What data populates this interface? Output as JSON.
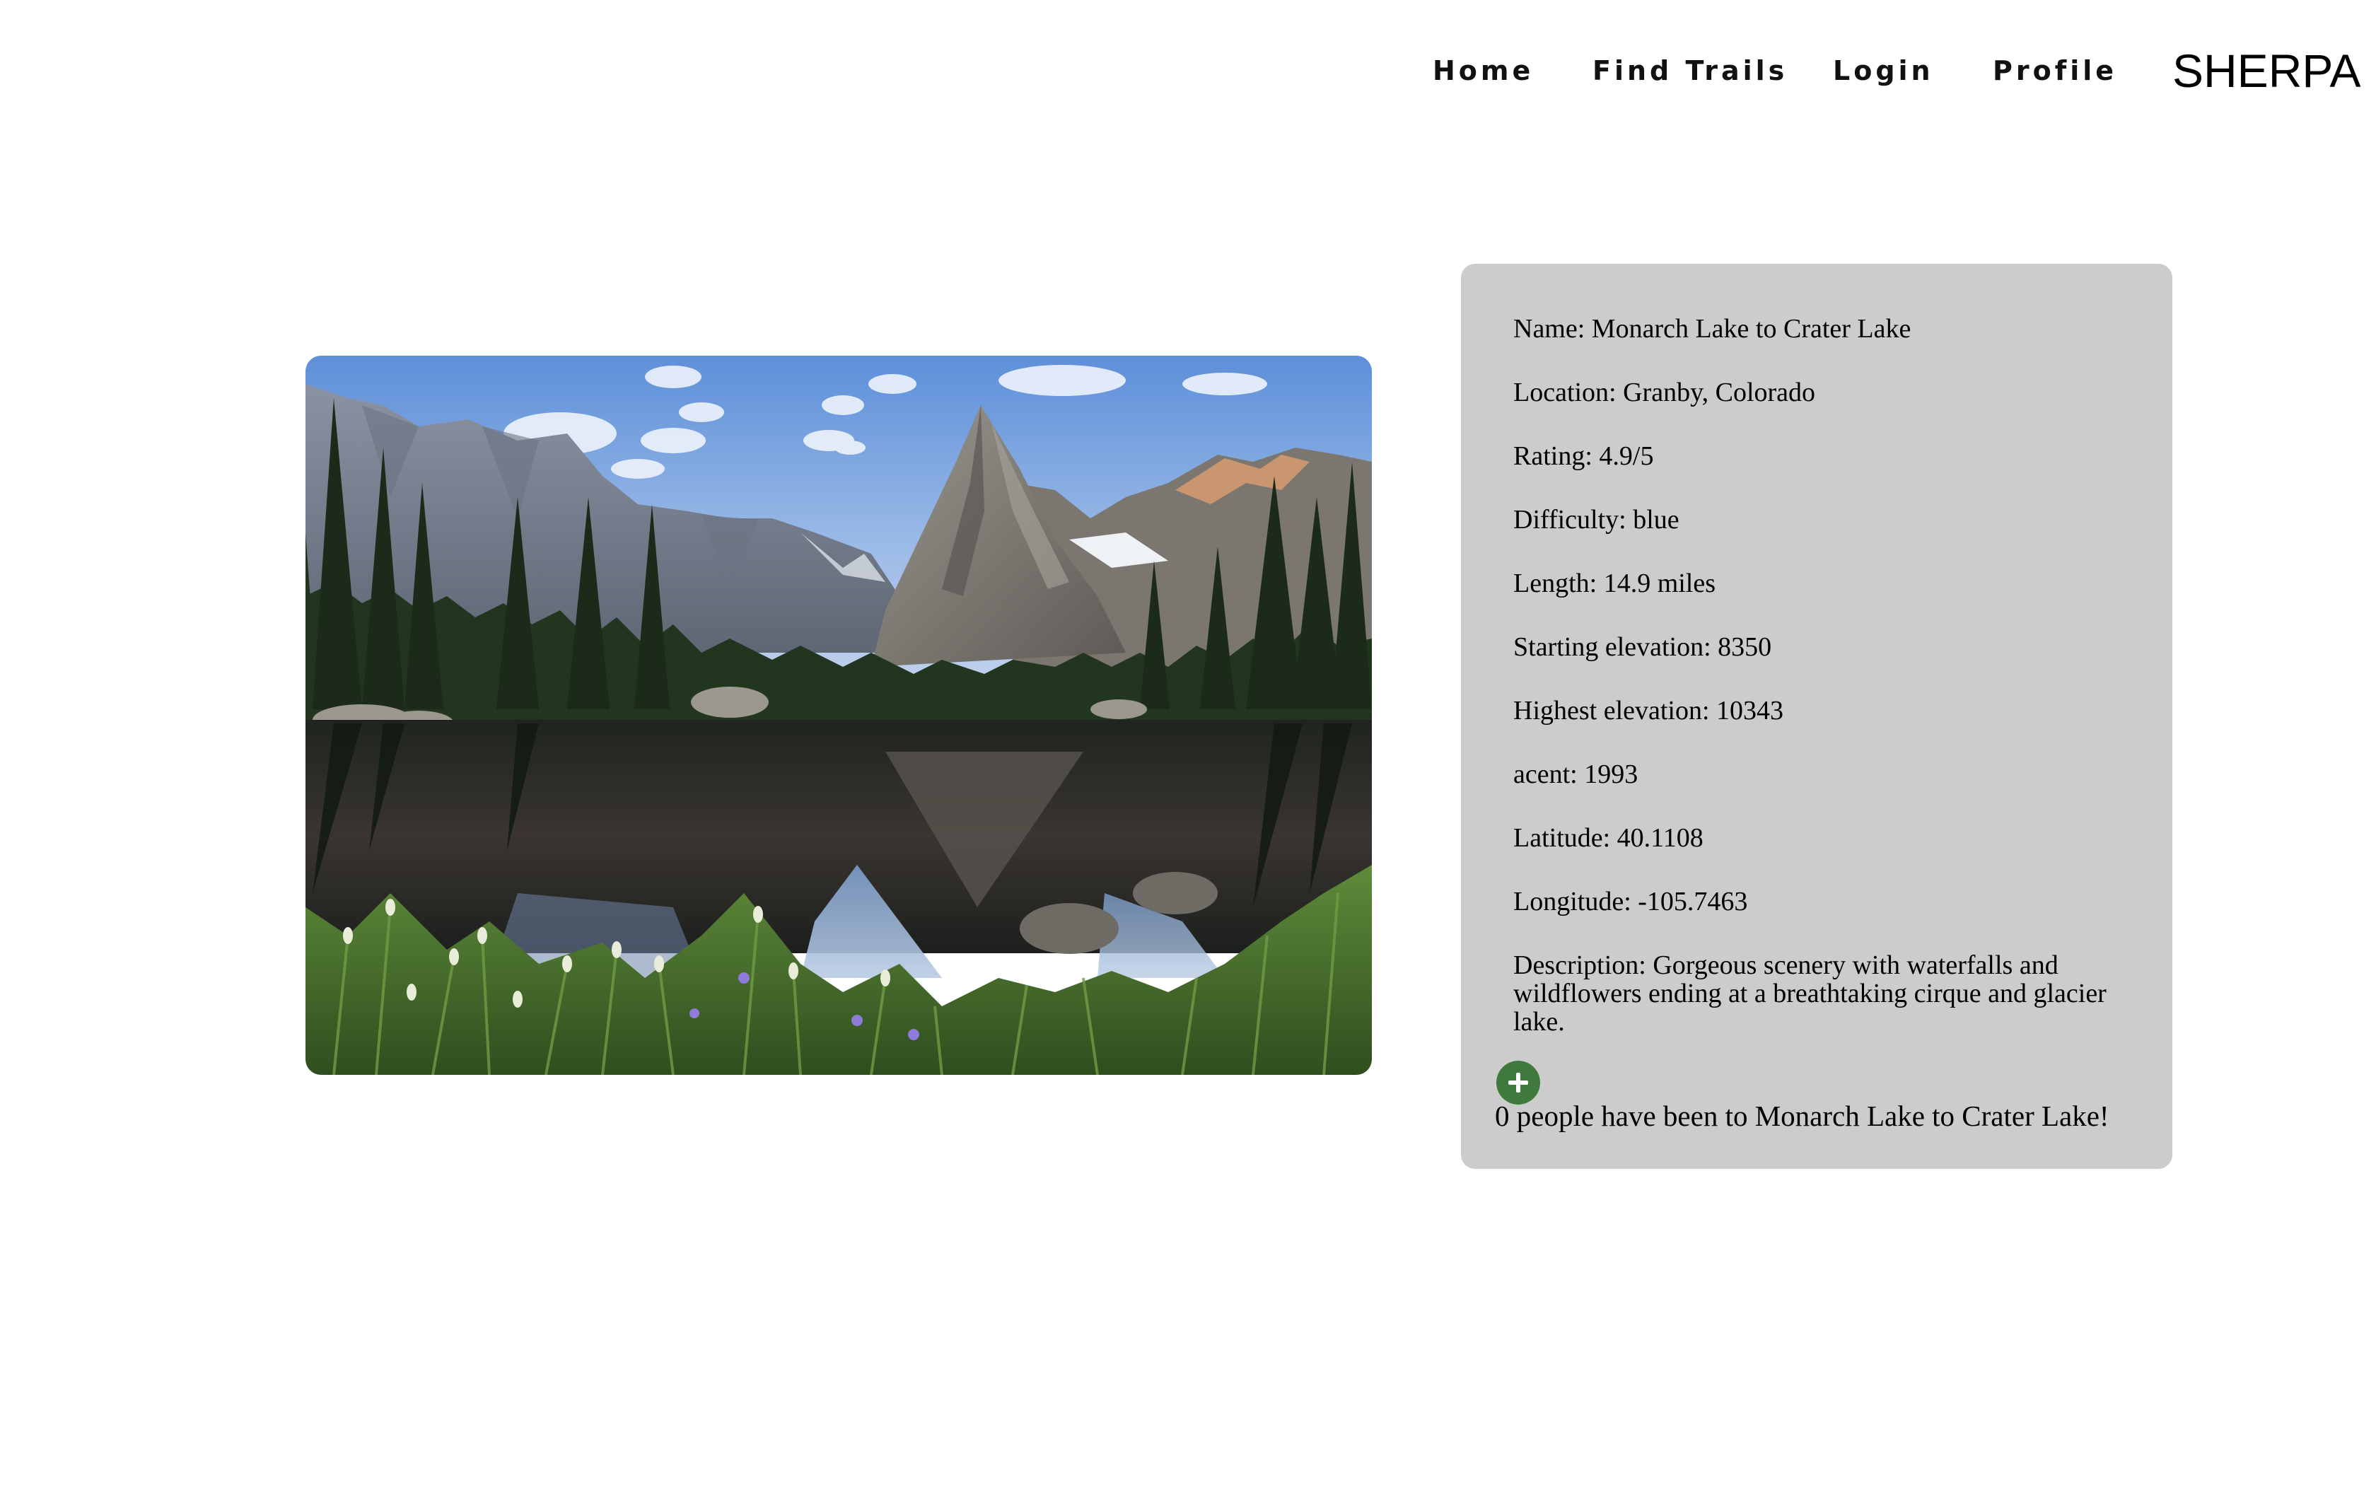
{
  "nav": {
    "links": [
      {
        "label": "Home"
      },
      {
        "label": "Find Trails"
      },
      {
        "label": "Login"
      },
      {
        "label": "Profile"
      }
    ],
    "brand": "SHERPA"
  },
  "trail": {
    "image_alt": "Mountain lake reflecting a granite spire",
    "fields": {
      "name": "Name: Monarch Lake to Crater Lake",
      "location": "Location: Granby, Colorado",
      "rating": "Rating: 4.9/5",
      "difficulty": "Difficulty: blue",
      "length": "Length: 14.9 miles",
      "starting_elevation": "Starting elevation: 8350",
      "highest_elevation": "Highest elevation: 10343",
      "acent": "acent: 1993",
      "latitude": "Latitude: 40.1108",
      "longitude": "Longitude: -105.7463",
      "description": "Description: Gorgeous scenery with waterfalls and wildflowers ending at a breathtaking cirque and glacier lake."
    },
    "add_icon": "plus-icon",
    "visitors_text": "0 people have been to Monarch Lake to Crater Lake!"
  },
  "colors": {
    "card_background": "#cccccc",
    "add_button": "#3f7a3c",
    "text": "#000000"
  }
}
